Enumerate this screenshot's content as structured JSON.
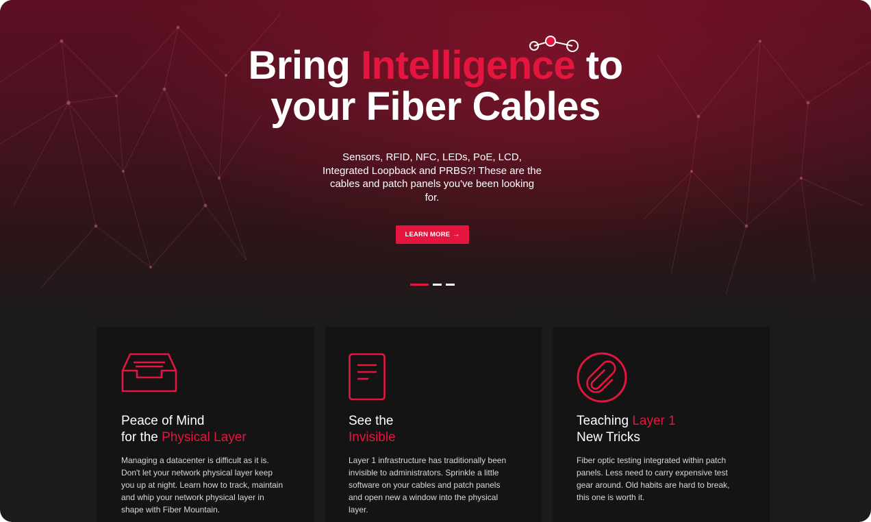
{
  "hero": {
    "title_part1": "Bring ",
    "title_accent": "Intelligence",
    "title_part2": " to",
    "title_line2": "your Fiber Cables",
    "subtitle": "Sensors, RFID, NFC, LEDs, PoE, LCD, Integrated Loopback and PRBS?! These are the cables and patch panels you've been looking for.",
    "cta_label": "LEARN MORE",
    "cta_icon": "arrow-right-icon",
    "decor_icon": "network-nodes-icon",
    "slides_total": 3,
    "slide_active": 1
  },
  "colors": {
    "accent": "#e4163f",
    "hero_top": "#5d0f22",
    "panel_bg": "#141415",
    "page_bg": "#1b1b1c"
  },
  "cards": [
    {
      "icon": "inbox-tray-icon",
      "title_line1": "Peace of Mind",
      "title_prefix2": "for the ",
      "title_accent": "Physical Layer",
      "body": "Managing a datacenter is difficult as it is. Don't let your network physical layer keep you up at night. Learn how to track, maintain and whip your network physical layer in shape with Fiber Mountain."
    },
    {
      "icon": "document-icon",
      "title_line1": "See the",
      "title_accent": "Invisible",
      "body": "Layer 1 infrastructure has traditionally been invisible to administrators. Sprinkle a little software on your cables and patch panels and open new a window into the physical layer."
    },
    {
      "icon": "paperclip-icon",
      "title_prefix": "Teaching ",
      "title_accent": "Layer 1",
      "title_line2": "New Tricks",
      "body": "Fiber optic testing integrated within patch panels. Less need to carry expensive test gear around. Old habits are hard to break, this one is worth it."
    }
  ]
}
